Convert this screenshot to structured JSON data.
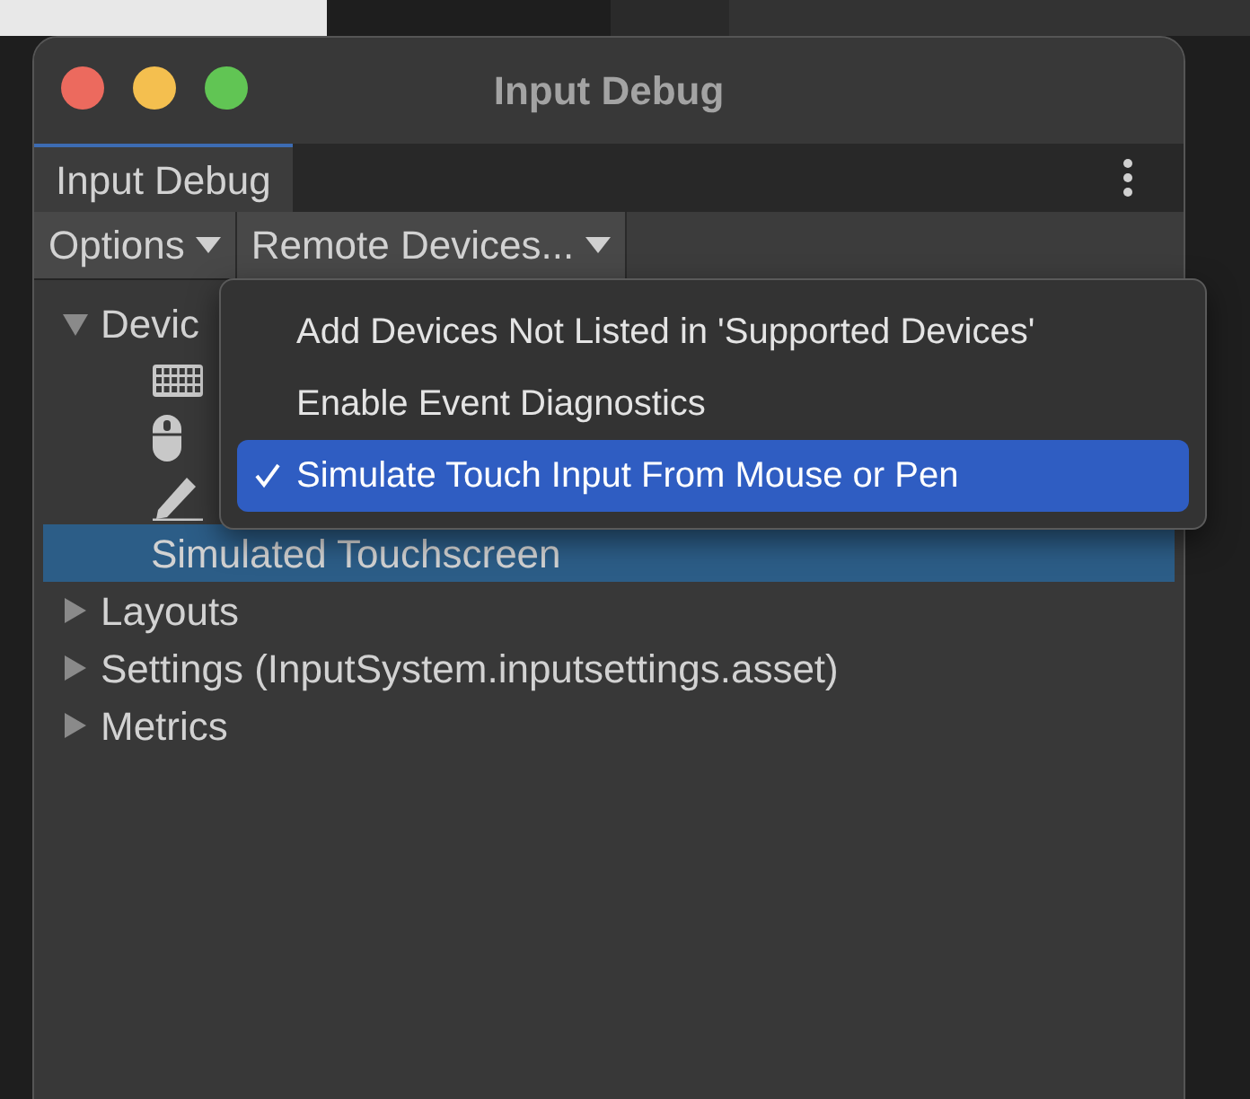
{
  "window": {
    "title": "Input Debug"
  },
  "tabs": [
    {
      "label": "Input Debug",
      "selected": true
    }
  ],
  "toolbar": [
    {
      "label": "Options"
    },
    {
      "label": "Remote Devices..."
    }
  ],
  "tree": [
    {
      "label": "Devic",
      "expanded": true,
      "selected": false,
      "children": [
        {
          "kind": "keyboard",
          "selected": false
        },
        {
          "kind": "mouse",
          "selected": false
        },
        {
          "kind": "pen",
          "selected": false
        },
        {
          "kind": "text",
          "label": "Simulated Touchscreen",
          "selected": true
        }
      ]
    },
    {
      "label": "Layouts",
      "expanded": false,
      "selected": false
    },
    {
      "label": "Settings (InputSystem.inputsettings.asset)",
      "expanded": false,
      "selected": false
    },
    {
      "label": "Metrics",
      "expanded": false,
      "selected": false
    }
  ],
  "menu": [
    {
      "label": "Add Devices Not Listed in 'Supported Devices'",
      "checked": false,
      "selected": false
    },
    {
      "label": "Enable Event Diagnostics",
      "checked": false,
      "selected": false
    },
    {
      "label": "Simulate Touch Input From Mouse or Pen",
      "checked": true,
      "selected": true
    }
  ]
}
